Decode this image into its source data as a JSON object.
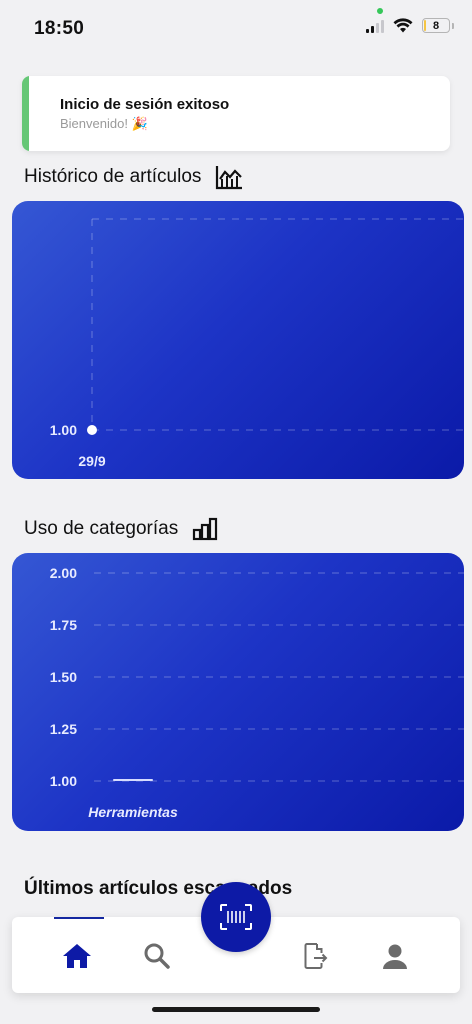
{
  "status_bar": {
    "time": "18:50",
    "battery_level": "8",
    "battery_fraction": 0.08
  },
  "toast": {
    "title": "Inicio de sesión exitoso",
    "subtitle": "Bienvenido! 🎉"
  },
  "history_section": {
    "title": "Histórico de artículos",
    "icon": "line-chart-icon",
    "chart_data": {
      "type": "line",
      "categories": [
        "29/9"
      ],
      "values": [
        1.0
      ],
      "y_tick_labels": [
        "1.00"
      ],
      "grid": true
    }
  },
  "categories_section": {
    "title": "Uso de categorías",
    "icon": "bar-chart-icon",
    "chart_data": {
      "type": "bar",
      "categories": [
        "Herramientas"
      ],
      "values": [
        1.0
      ],
      "ylim": [
        1.0,
        2.0
      ],
      "y_tick_labels": [
        "2.00",
        "1.75",
        "1.50",
        "1.25",
        "1.00"
      ],
      "grid": true
    }
  },
  "recent_section": {
    "title": "Últimos artículos escaneados"
  },
  "bottom_nav": {
    "items": [
      {
        "name": "home",
        "icon": "home-icon",
        "active": true
      },
      {
        "name": "search",
        "icon": "search-icon",
        "active": false
      },
      {
        "name": "export",
        "icon": "file-export-icon",
        "active": false
      },
      {
        "name": "profile",
        "icon": "user-icon",
        "active": false
      }
    ],
    "fab_icon": "barcode-scan-icon"
  },
  "colors": {
    "accent": "#0d1aa6",
    "success": "#66c776",
    "card_gradient_light": "#3557d4",
    "card_gradient_dark": "#0b1aa8"
  }
}
